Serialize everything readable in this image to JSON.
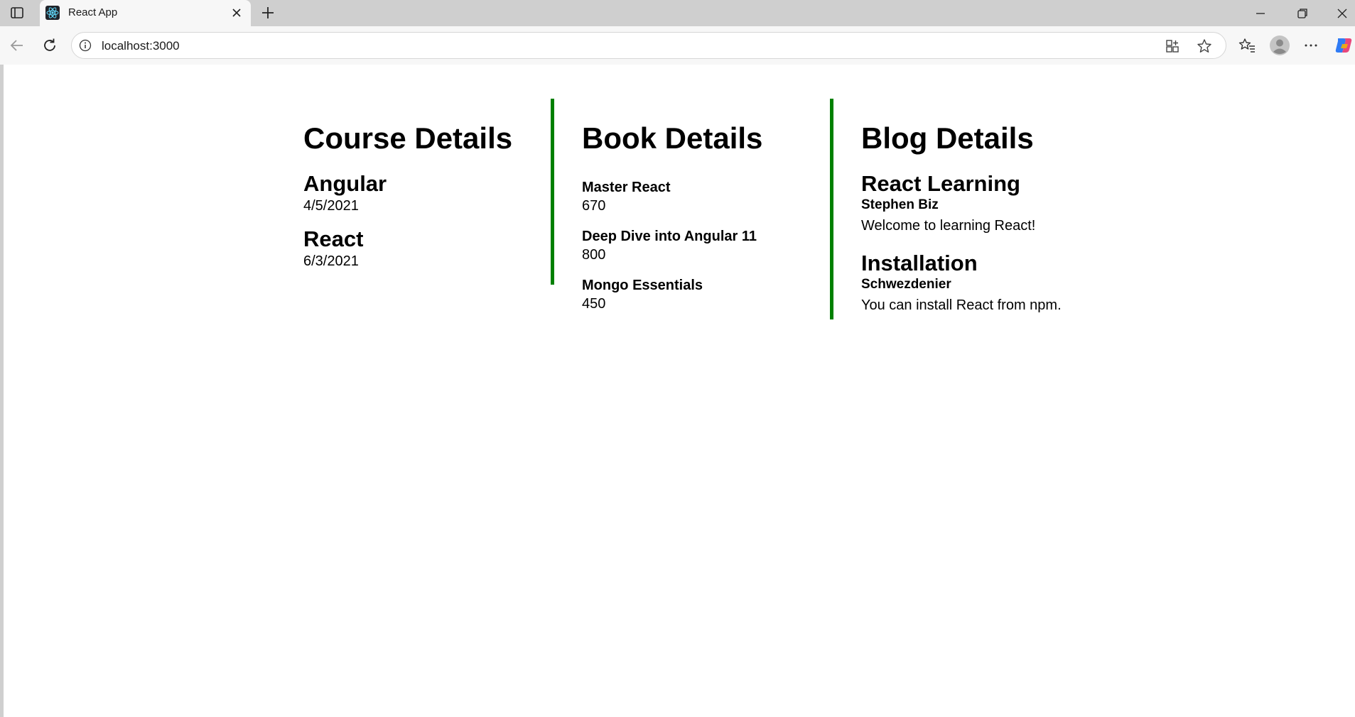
{
  "browser": {
    "tab_title": "React App",
    "url": "localhost:3000"
  },
  "colors": {
    "divider": "#008000",
    "page_background": "#ffffff",
    "chrome_background": "#cfcfcf"
  },
  "page": {
    "course": {
      "title": "Course Details",
      "items": [
        {
          "name": "Angular",
          "date": "4/5/2021"
        },
        {
          "name": "React",
          "date": "6/3/2021"
        }
      ]
    },
    "book": {
      "title": "Book Details",
      "items": [
        {
          "name": "Master React",
          "price": "670"
        },
        {
          "name": "Deep Dive into Angular 11",
          "price": "800"
        },
        {
          "name": "Mongo Essentials",
          "price": "450"
        }
      ]
    },
    "blog": {
      "title": "Blog Details",
      "items": [
        {
          "title": "React Learning",
          "author": "Stephen Biz",
          "content": "Welcome to learning React!"
        },
        {
          "title": "Installation",
          "author": "Schwezdenier",
          "content": "You can install React from npm."
        }
      ]
    }
  }
}
